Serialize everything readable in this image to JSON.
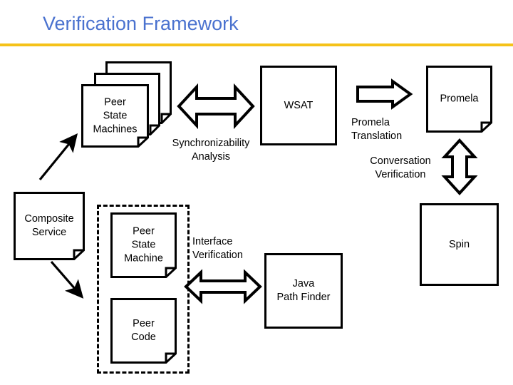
{
  "slide": {
    "title": "Verification Framework",
    "title_color": "#4a72cf",
    "rule_color": "#f5c219",
    "background": "#ffffff",
    "stroke_color": "#000000"
  },
  "nodes": {
    "peer_state_machines": {
      "label": "Peer\nState\nMachines",
      "shape": "stacked-document",
      "stack_count": 3
    },
    "wsat": {
      "label": "WSAT",
      "shape": "rectangle"
    },
    "promela": {
      "label": "Promela",
      "shape": "document"
    },
    "spin": {
      "label": "Spin",
      "shape": "rectangle"
    },
    "composite_service": {
      "label": "Composite\nService",
      "shape": "document"
    },
    "peer_state_machine": {
      "label": "Peer\nState\nMachine",
      "shape": "document"
    },
    "peer_code": {
      "label": "Peer\nCode",
      "shape": "document"
    },
    "java_path_finder": {
      "label": "Java\nPath Finder",
      "shape": "rectangle"
    }
  },
  "edge_labels": {
    "synchronizability_analysis": "Synchronizability\nAnalysis",
    "promela_translation": "Promela\nTranslation",
    "conversation_verification": "Conversation\nVerification",
    "interface_verification": "Interface\nVerification"
  },
  "arrows": {
    "psm_wsat": "double-horizontal-block-arrow",
    "wsat_promela": "right-block-arrow",
    "promela_spin": "double-vertical-block-arrow",
    "group_jpf": "double-horizontal-block-arrow",
    "composite_to_psm": "line-arrow-up-right",
    "composite_to_group": "line-arrow-down-right"
  }
}
